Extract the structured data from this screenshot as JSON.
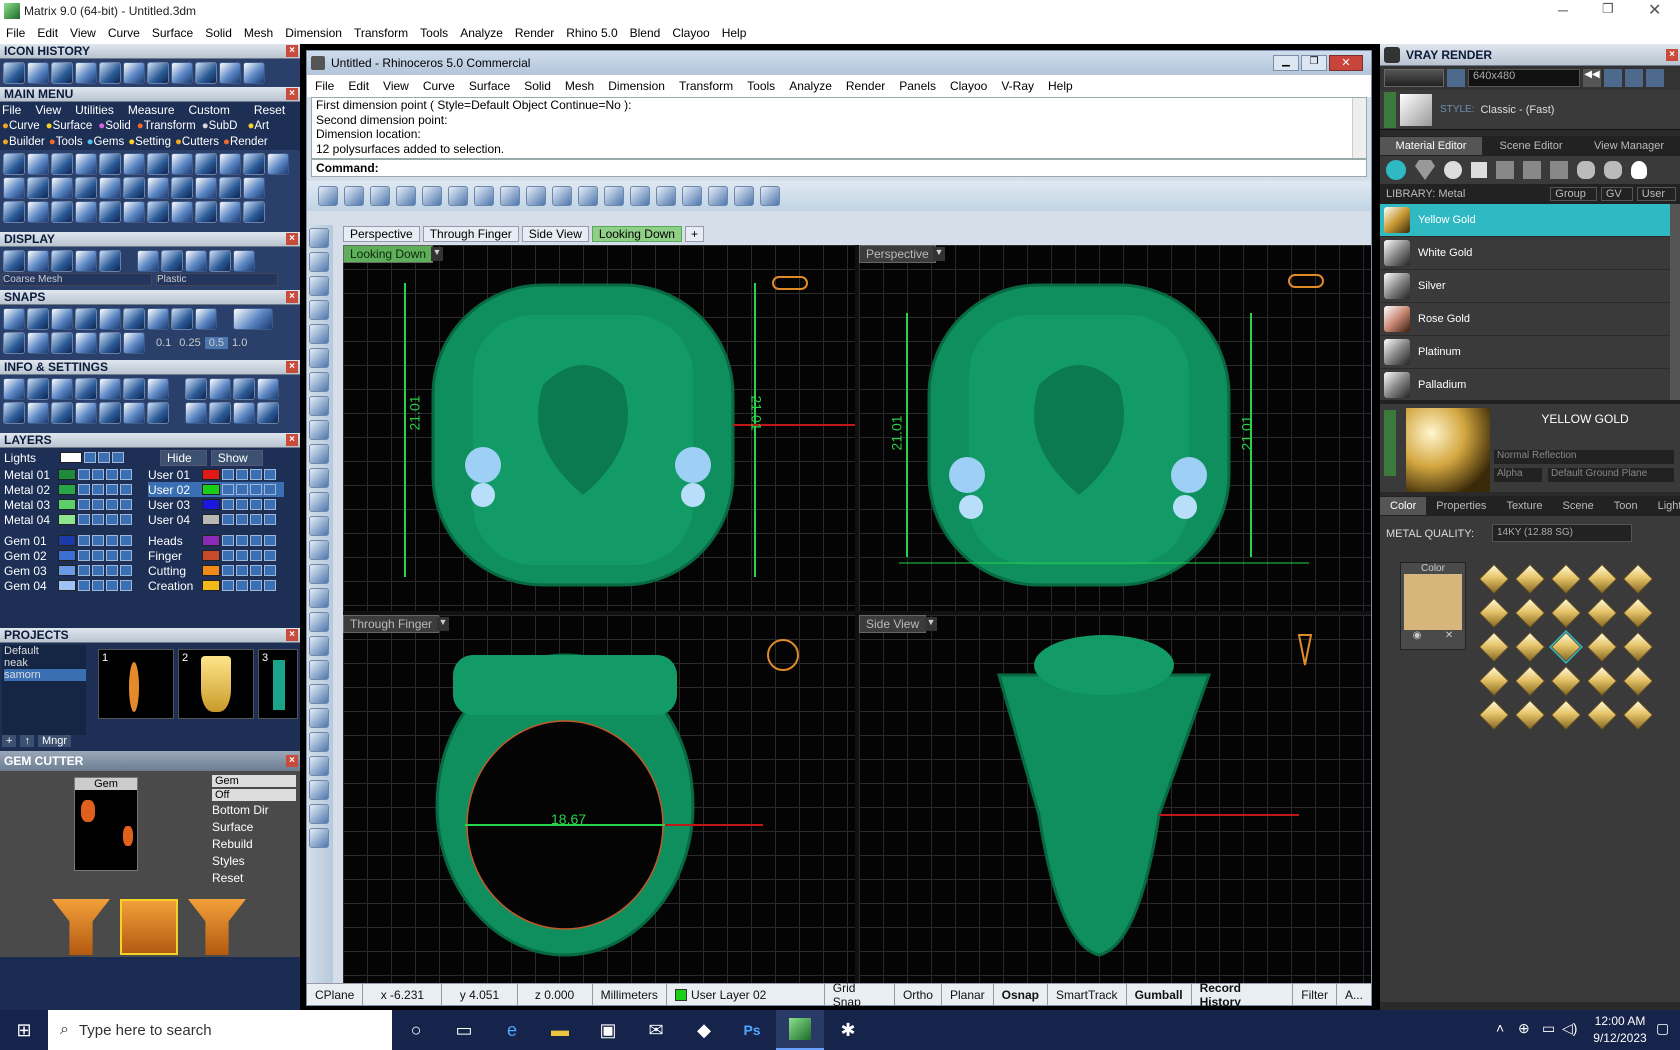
{
  "outer": {
    "title": "Matrix 9.0 (64-bit) - Untitled.3dm",
    "menu": [
      "File",
      "Edit",
      "View",
      "Curve",
      "Surface",
      "Solid",
      "Mesh",
      "Dimension",
      "Transform",
      "Tools",
      "Analyze",
      "Render",
      "Rhino 5.0",
      "Blend",
      "Clayoo",
      "Help"
    ]
  },
  "left": {
    "icon_history": "ICON HISTORY",
    "main_menu": {
      "title": "MAIN MENU",
      "row1": [
        "File",
        "View",
        "Utilities",
        "Measure",
        "Custom",
        "Reset"
      ],
      "row2": [
        "Curve",
        "Surface",
        "Solid",
        "Transform",
        "SubD",
        "Art"
      ],
      "row3": [
        "Builder",
        "Tools",
        "Gems",
        "Setting",
        "Cutters",
        "Render"
      ]
    },
    "display": {
      "title": "DISPLAY",
      "mesh": "Coarse Mesh",
      "material": "Plastic"
    },
    "snaps": {
      "title": "SNAPS",
      "values": [
        "0.1",
        "0.25",
        "0.5",
        "1.0"
      ]
    },
    "info": "INFO & SETTINGS",
    "layers": {
      "title": "LAYERS",
      "lights": "Lights",
      "hide": "Hide",
      "show": "Show",
      "left": [
        {
          "name": "Metal 01",
          "color": "#1e8a3c"
        },
        {
          "name": "Metal 02",
          "color": "#2aa64a"
        },
        {
          "name": "Metal 03",
          "color": "#5ccf6b"
        },
        {
          "name": "Metal 04",
          "color": "#8fe48f"
        },
        {
          "name": "Gem 01",
          "color": "#1a3aa8"
        },
        {
          "name": "Gem 02",
          "color": "#3b6fd1"
        },
        {
          "name": "Gem 03",
          "color": "#6a9ae6"
        },
        {
          "name": "Gem 04",
          "color": "#9fc2f4"
        }
      ],
      "right": [
        {
          "name": "User 01",
          "color": "#e01818"
        },
        {
          "name": "User 02",
          "color": "#18d018"
        },
        {
          "name": "User 03",
          "color": "#1818e0"
        },
        {
          "name": "User 04",
          "color": "#b8b8b8"
        },
        {
          "name": "Heads",
          "color": "#8a2ab8"
        },
        {
          "name": "Finger",
          "color": "#c84a2a"
        },
        {
          "name": "Cutting",
          "color": "#f08a18"
        },
        {
          "name": "Creation",
          "color": "#f0b818"
        }
      ]
    },
    "projects": {
      "title": "PROJECTS",
      "list": [
        "Default",
        "neak",
        "samorn"
      ],
      "thumbs": [
        "1",
        "2",
        "3"
      ],
      "mngr": "Mngr"
    },
    "gem_cutter": {
      "title": "GEM CUTTER",
      "preview_label": "Gem",
      "options": [
        "Gem",
        "Off",
        "Bottom Dir",
        "Surface",
        "Rebuild",
        "Styles",
        "Reset"
      ]
    }
  },
  "rhino": {
    "title": "Untitled - Rhinoceros 5.0 Commercial",
    "menu": [
      "File",
      "Edit",
      "View",
      "Curve",
      "Surface",
      "Solid",
      "Mesh",
      "Dimension",
      "Transform",
      "Tools",
      "Analyze",
      "Render",
      "Panels",
      "Clayoo",
      "V-Ray",
      "Help"
    ],
    "history": [
      "First dimension point ( Style=Default  Object  Continue=No ):",
      "Second dimension point:",
      "Dimension location:",
      "12 polysurfaces added to selection."
    ],
    "command": "Command:",
    "tabs": [
      "Perspective",
      "Through Finger",
      "Side View",
      "Looking Down"
    ],
    "viewports": {
      "tl": "Looking Down",
      "tr": "Perspective",
      "bl": "Through Finger",
      "br": "Side View"
    },
    "dims": {
      "tl_a": "21.01",
      "tl_b": "21.01",
      "tr_a": "21.01",
      "tr_b": "21.01",
      "bl": "18.67"
    },
    "status": {
      "cplane": "CPlane",
      "x": "x -6.231",
      "y": "y 4.051",
      "z": "z 0.000",
      "units": "Millimeters",
      "layer": "User Layer 02",
      "items": [
        "Grid Snap",
        "Ortho",
        "Planar",
        "Osnap",
        "SmartTrack",
        "Gumball",
        "Record History",
        "Filter",
        "A..."
      ]
    }
  },
  "vray": {
    "title": "VRAY RENDER",
    "resolution": "640x480",
    "style_label": "STYLE:",
    "style": "Classic - (Fast)",
    "tabs": [
      "Material Editor",
      "Scene Editor",
      "View Manager"
    ],
    "library": "LIBRARY: Metal",
    "lib_opts": [
      "Group",
      "GV",
      "User"
    ],
    "materials": [
      "Yellow Gold",
      "White Gold",
      "Silver",
      "Rose Gold",
      "Platinum",
      "Palladium"
    ],
    "material_name": "YELLOW GOLD",
    "reflection": "Normal Reflection",
    "alpha": "Alpha",
    "ground": "Default Ground Plane",
    "subtabs": [
      "Color",
      "Properties",
      "Texture",
      "Scene",
      "Toon",
      "Lights"
    ],
    "metal_quality_label": "METAL QUALITY:",
    "metal_quality": "14KY        (12.88 SG)",
    "color_label": "Color"
  },
  "taskbar": {
    "search": "Type here to search",
    "time": "12:00 AM",
    "date": "9/12/2023"
  }
}
